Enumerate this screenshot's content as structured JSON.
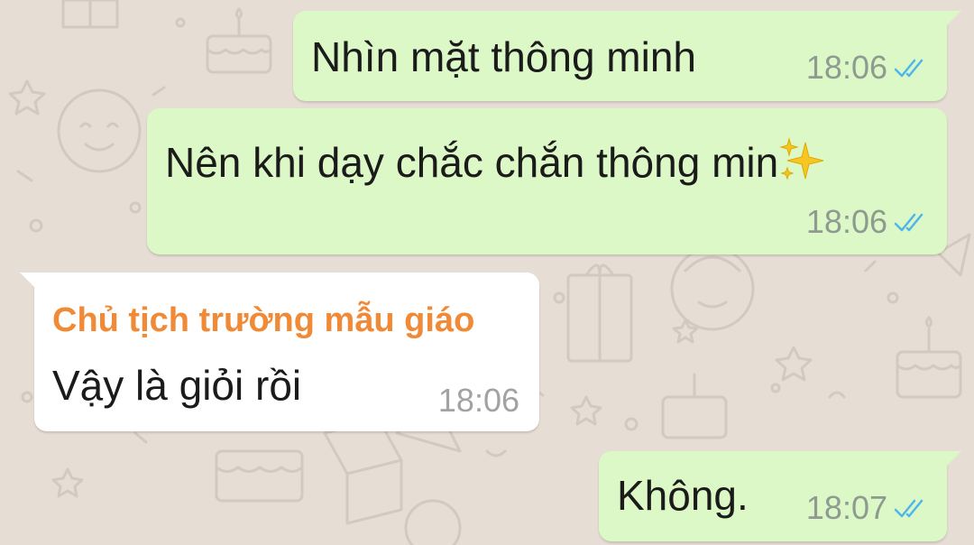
{
  "chat": {
    "messages": [
      {
        "direction": "outgoing",
        "text": "Nhìn mặt thông minh",
        "time": "18:06",
        "status_icon": "double-check-read-icon"
      },
      {
        "direction": "outgoing",
        "text": "Nên khi dạy chắc chắn thông min",
        "emoji": "sparkles-emoji",
        "time": "18:06",
        "status_icon": "double-check-read-icon"
      },
      {
        "direction": "incoming",
        "sender": "Chủ tịch trường mẫu giáo",
        "text": "Vậy là giỏi rồi",
        "time": "18:06"
      },
      {
        "direction": "outgoing",
        "text": "Không.",
        "time": "18:07",
        "status_icon": "double-check-read-icon"
      }
    ]
  },
  "colors": {
    "wallpaper": "#e6ddd4",
    "outgoing_bubble": "#dcf8c6",
    "incoming_bubble": "#ffffff",
    "sender_name": "#f08a36",
    "read_ticks": "#4fb6ec",
    "doodle_stroke": "#d6ccc2"
  }
}
